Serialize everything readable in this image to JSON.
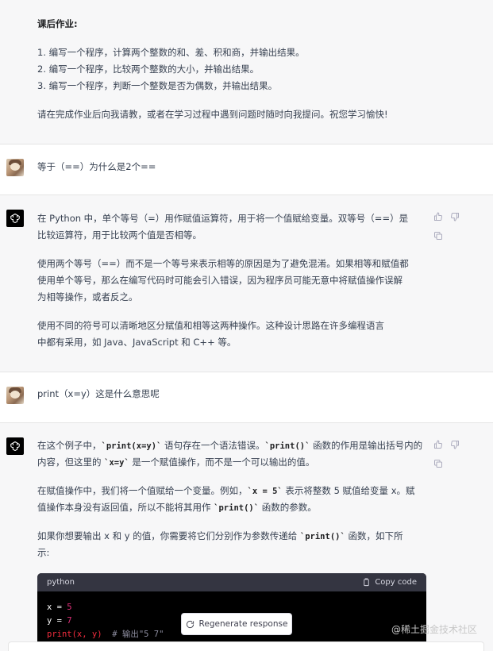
{
  "homework": {
    "title": "课后作业:",
    "items": [
      "1.  编写一个程序，计算两个整数的和、差、积和商，并输出结果。",
      "2.  编写一个程序，比较两个整数的大小，并输出结果。",
      "3.  编写一个程序，判断一个整数是否为偶数，并输出结果。"
    ],
    "closing": "请在完成作业后向我请教，或者在学习过程中遇到问题时随时向我提问。祝您学习愉快!"
  },
  "user_msg_1": "等于（==）为什么是2个==",
  "assistant_1": {
    "para1_line1": "在 Python 中，单个等号（=）用作赋值运算符，用于将一个值赋给变量。双等号（==）是",
    "para1_line2": "比较运算符，用于比较两个值是否相等。",
    "para2_line1": "使用两个等号（==）而不是一个等号来表示相等的原因是为了避免混淆。如果相等和赋值都",
    "para2_line2": "使用单个等号，那么在编写代码时可能会引入错误，因为程序员可能无意中将赋值操作误解",
    "para2_line3": "为相等操作，或者反之。",
    "para3_line1": "使用不同的符号可以清晰地区分赋值和相等这两种操作。这种设计思路在许多编程语言",
    "para3_line2": "中都有采用，如 Java、JavaScript 和 C++ 等。"
  },
  "user_msg_2": "print（x=y）这是什么意思呢",
  "assistant_2": {
    "p1_a": "在这个例子中，",
    "p1_code1": "`print(x=y)`",
    "p1_b": " 语句存在一个语法错误。",
    "p1_code2": "`print()`",
    "p1_c": " 函数的作用是输出括号内的",
    "p1_line2_a": "内容，但这里的 ",
    "p1_code3": "`x=y`",
    "p1_line2_b": " 是一个赋值操作，而不是一个可以输出的值。",
    "p2_a": "在赋值操作中，我们将一个值赋给一个变量。例如，",
    "p2_code1": "`x = 5`",
    "p2_b": " 表示将整数 5 赋值给变量 x。赋",
    "p2_line2_a": "值操作本身没有返回值，所以不能将其用作 ",
    "p2_code2": "`print()`",
    "p2_line2_b": " 函数的参数。",
    "p3_a": "如果你想要输出 x 和 y 的值，你需要将它们分别作为参数传递给 ",
    "p3_code": "`print()`",
    "p3_b": " 函数，如下所",
    "p3_line2": "示:"
  },
  "code_block": {
    "language": "python",
    "copy_label": "Copy code",
    "line1_var": "x",
    "line1_op": " = ",
    "line1_val": "5",
    "line2_var": "y",
    "line2_op": " = ",
    "line2_val": "7",
    "line3_code": "print(x, y)",
    "line3_comment": "  # 输出\"5 7\""
  },
  "regenerate_label": "Regenerate response",
  "watermark": "@稀土掘金技术社区",
  "icons": {
    "thumbs_up": "thumbs-up-icon",
    "thumbs_down": "thumbs-down-icon",
    "copy": "copy-icon",
    "refresh": "refresh-icon",
    "openai": "openai-logo-icon"
  }
}
